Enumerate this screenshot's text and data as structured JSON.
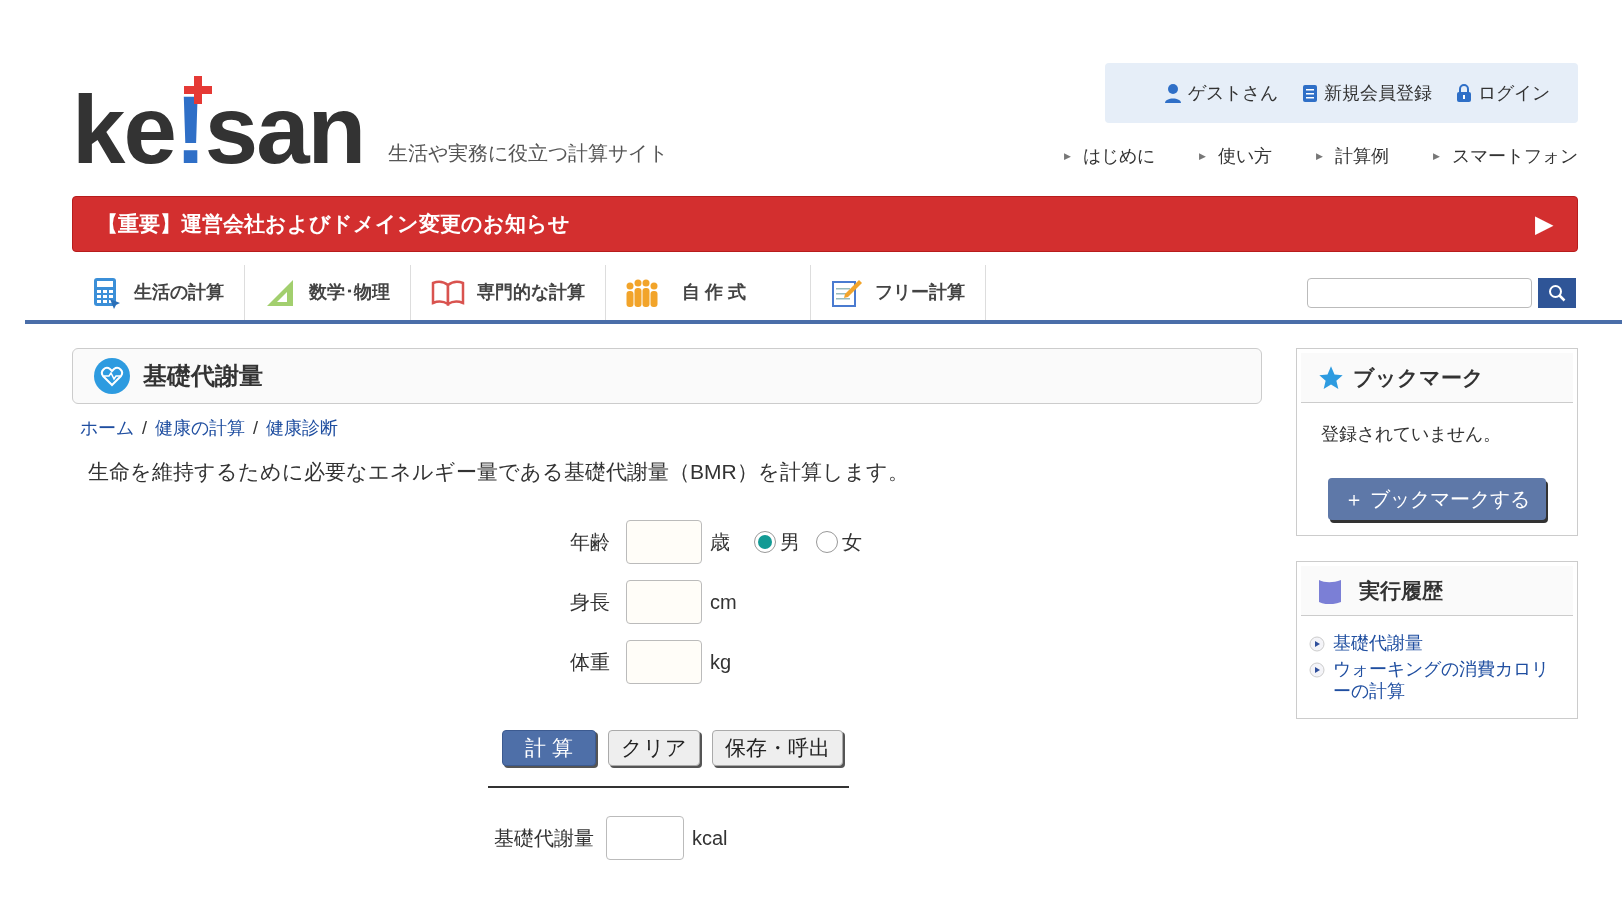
{
  "logo": {
    "before": "ke",
    "mark": "!",
    "after": "san"
  },
  "tagline": "生活や実務に役立つ計算サイト",
  "user_links": [
    {
      "kind": "user",
      "label": "ゲストさん"
    },
    {
      "kind": "register",
      "label": "新規会員登録"
    },
    {
      "kind": "lock",
      "label": "ログイン"
    }
  ],
  "sub_links": [
    "はじめに",
    "使い方",
    "計算例",
    "スマートフォン"
  ],
  "banner": {
    "text": "【重要】運営会社およびドメイン変更のお知らせ",
    "arrow": "▶"
  },
  "tabs": [
    {
      "kind": "calculator",
      "label": "生活の計算",
      "selected": false
    },
    {
      "kind": "ruler",
      "label": "数学･物理",
      "selected": false
    },
    {
      "kind": "book",
      "label": "専門的な計算",
      "selected": false
    },
    {
      "kind": "people",
      "label": "自 作 式",
      "selected": false
    },
    {
      "kind": "memo",
      "label": "フリー計算",
      "selected": false
    }
  ],
  "page_title": "基礎代謝量",
  "breadcrumb": [
    "ホーム",
    "健康の計算",
    "健康診断"
  ],
  "breadcrumb_separator": "/",
  "description": "生命を維持するために必要なエネルギー量である基礎代謝量（BMR）を計算します。",
  "fields": [
    {
      "label": "年齢",
      "unit": "歳"
    },
    {
      "label": "身長",
      "unit": "cm"
    },
    {
      "label": "体重",
      "unit": "kg"
    }
  ],
  "sex_options": [
    {
      "label": "男",
      "selected": true
    },
    {
      "label": "女",
      "selected": false
    }
  ],
  "buttons": [
    {
      "kind": "primary",
      "label": "計 算"
    },
    {
      "kind": "plain",
      "label": "クリア"
    },
    {
      "kind": "plain",
      "label": "保存・呼出"
    }
  ],
  "result": {
    "label": "基礎代謝量",
    "unit": "kcal"
  },
  "bookmark": {
    "title": "ブックマーク",
    "empty_text": "登録されていません。",
    "button": "＋ ブックマークする"
  },
  "history": {
    "title": "実行履歴",
    "items": [
      "基礎代謝量",
      "ウォーキングの消費カロリーの計算"
    ]
  }
}
